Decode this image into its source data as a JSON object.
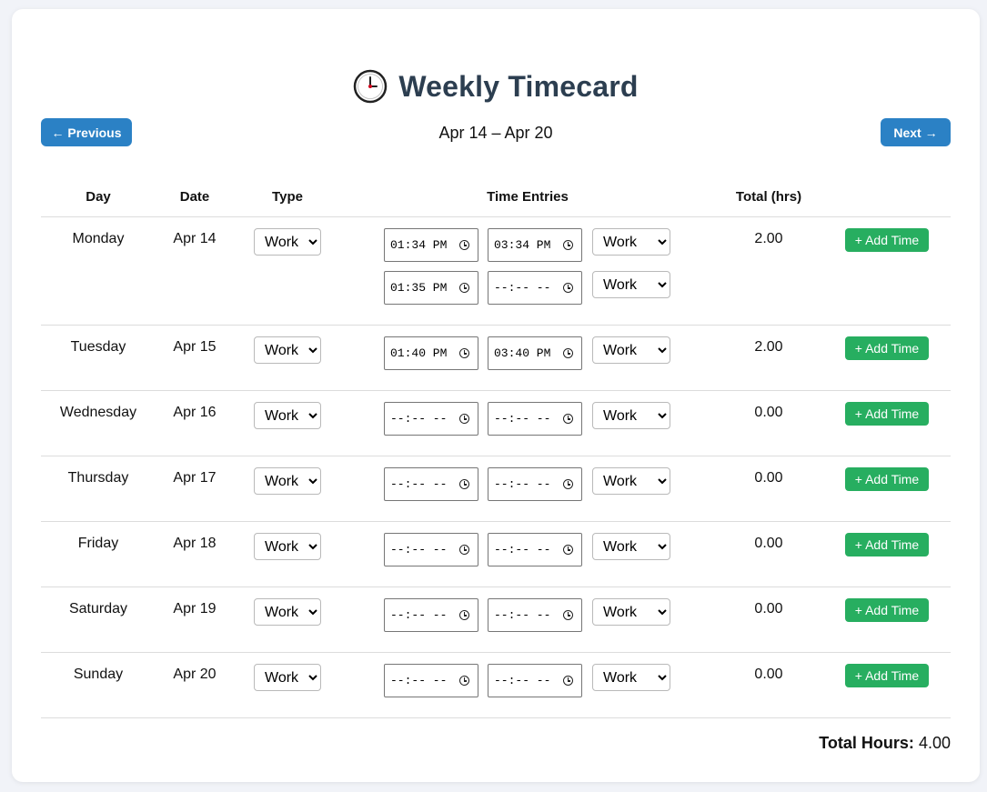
{
  "title": "Weekly Timecard",
  "nav": {
    "prev_label": "← Previous",
    "next_label": "Next →",
    "week_range": "Apr 14 – Apr 20"
  },
  "columns": {
    "day": "Day",
    "date": "Date",
    "type": "Type",
    "entries": "Time Entries",
    "total": "Total (hrs)"
  },
  "add_label": "+ Add Time",
  "type_options": [
    "Work"
  ],
  "rows": [
    {
      "day": "Monday",
      "date": "Apr 14",
      "type": "Work",
      "total": "2.00",
      "entries": [
        {
          "start": "01:34 PM",
          "end": "03:34 PM",
          "kind": "Work"
        },
        {
          "start": "01:35 PM",
          "end": "--:-- --",
          "kind": "Work"
        }
      ]
    },
    {
      "day": "Tuesday",
      "date": "Apr 15",
      "type": "Work",
      "total": "2.00",
      "entries": [
        {
          "start": "01:40 PM",
          "end": "03:40 PM",
          "kind": "Work"
        }
      ]
    },
    {
      "day": "Wednesday",
      "date": "Apr 16",
      "type": "Work",
      "total": "0.00",
      "entries": [
        {
          "start": "--:-- --",
          "end": "--:-- --",
          "kind": "Work"
        }
      ]
    },
    {
      "day": "Thursday",
      "date": "Apr 17",
      "type": "Work",
      "total": "0.00",
      "entries": [
        {
          "start": "--:-- --",
          "end": "--:-- --",
          "kind": "Work"
        }
      ]
    },
    {
      "day": "Friday",
      "date": "Apr 18",
      "type": "Work",
      "total": "0.00",
      "entries": [
        {
          "start": "--:-- --",
          "end": "--:-- --",
          "kind": "Work"
        }
      ]
    },
    {
      "day": "Saturday",
      "date": "Apr 19",
      "type": "Work",
      "total": "0.00",
      "entries": [
        {
          "start": "--:-- --",
          "end": "--:-- --",
          "kind": "Work"
        }
      ]
    },
    {
      "day": "Sunday",
      "date": "Apr 20",
      "type": "Work",
      "total": "0.00",
      "entries": [
        {
          "start": "--:-- --",
          "end": "--:-- --",
          "kind": "Work"
        }
      ]
    }
  ],
  "summary": {
    "label": "Total Hours:",
    "value": "4.00"
  }
}
